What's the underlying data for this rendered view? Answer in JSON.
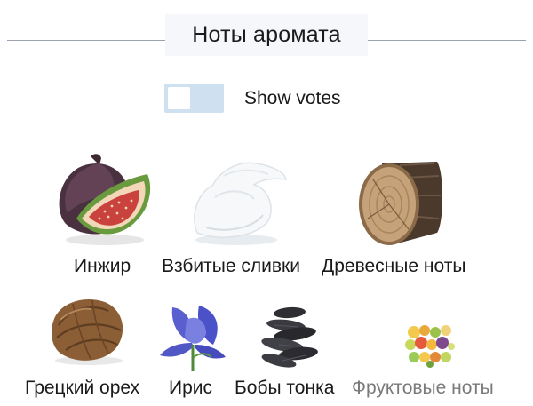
{
  "header": {
    "title": "Ноты аромата"
  },
  "toggle": {
    "label": "Show votes",
    "checked": false
  },
  "notes": [
    {
      "label": "Инжир",
      "icon": "fig-icon"
    },
    {
      "label": "Взбитые сливки",
      "icon": "whipped-cream-icon"
    },
    {
      "label": "Древесные ноты",
      "icon": "wood-log-icon"
    },
    {
      "label": "Грецкий орех",
      "icon": "walnut-icon"
    },
    {
      "label": "Ирис",
      "icon": "iris-flower-icon"
    },
    {
      "label": "Бобы тонка",
      "icon": "tonka-beans-icon"
    },
    {
      "label": "Фруктовые ноты",
      "icon": "fruits-icon"
    }
  ]
}
